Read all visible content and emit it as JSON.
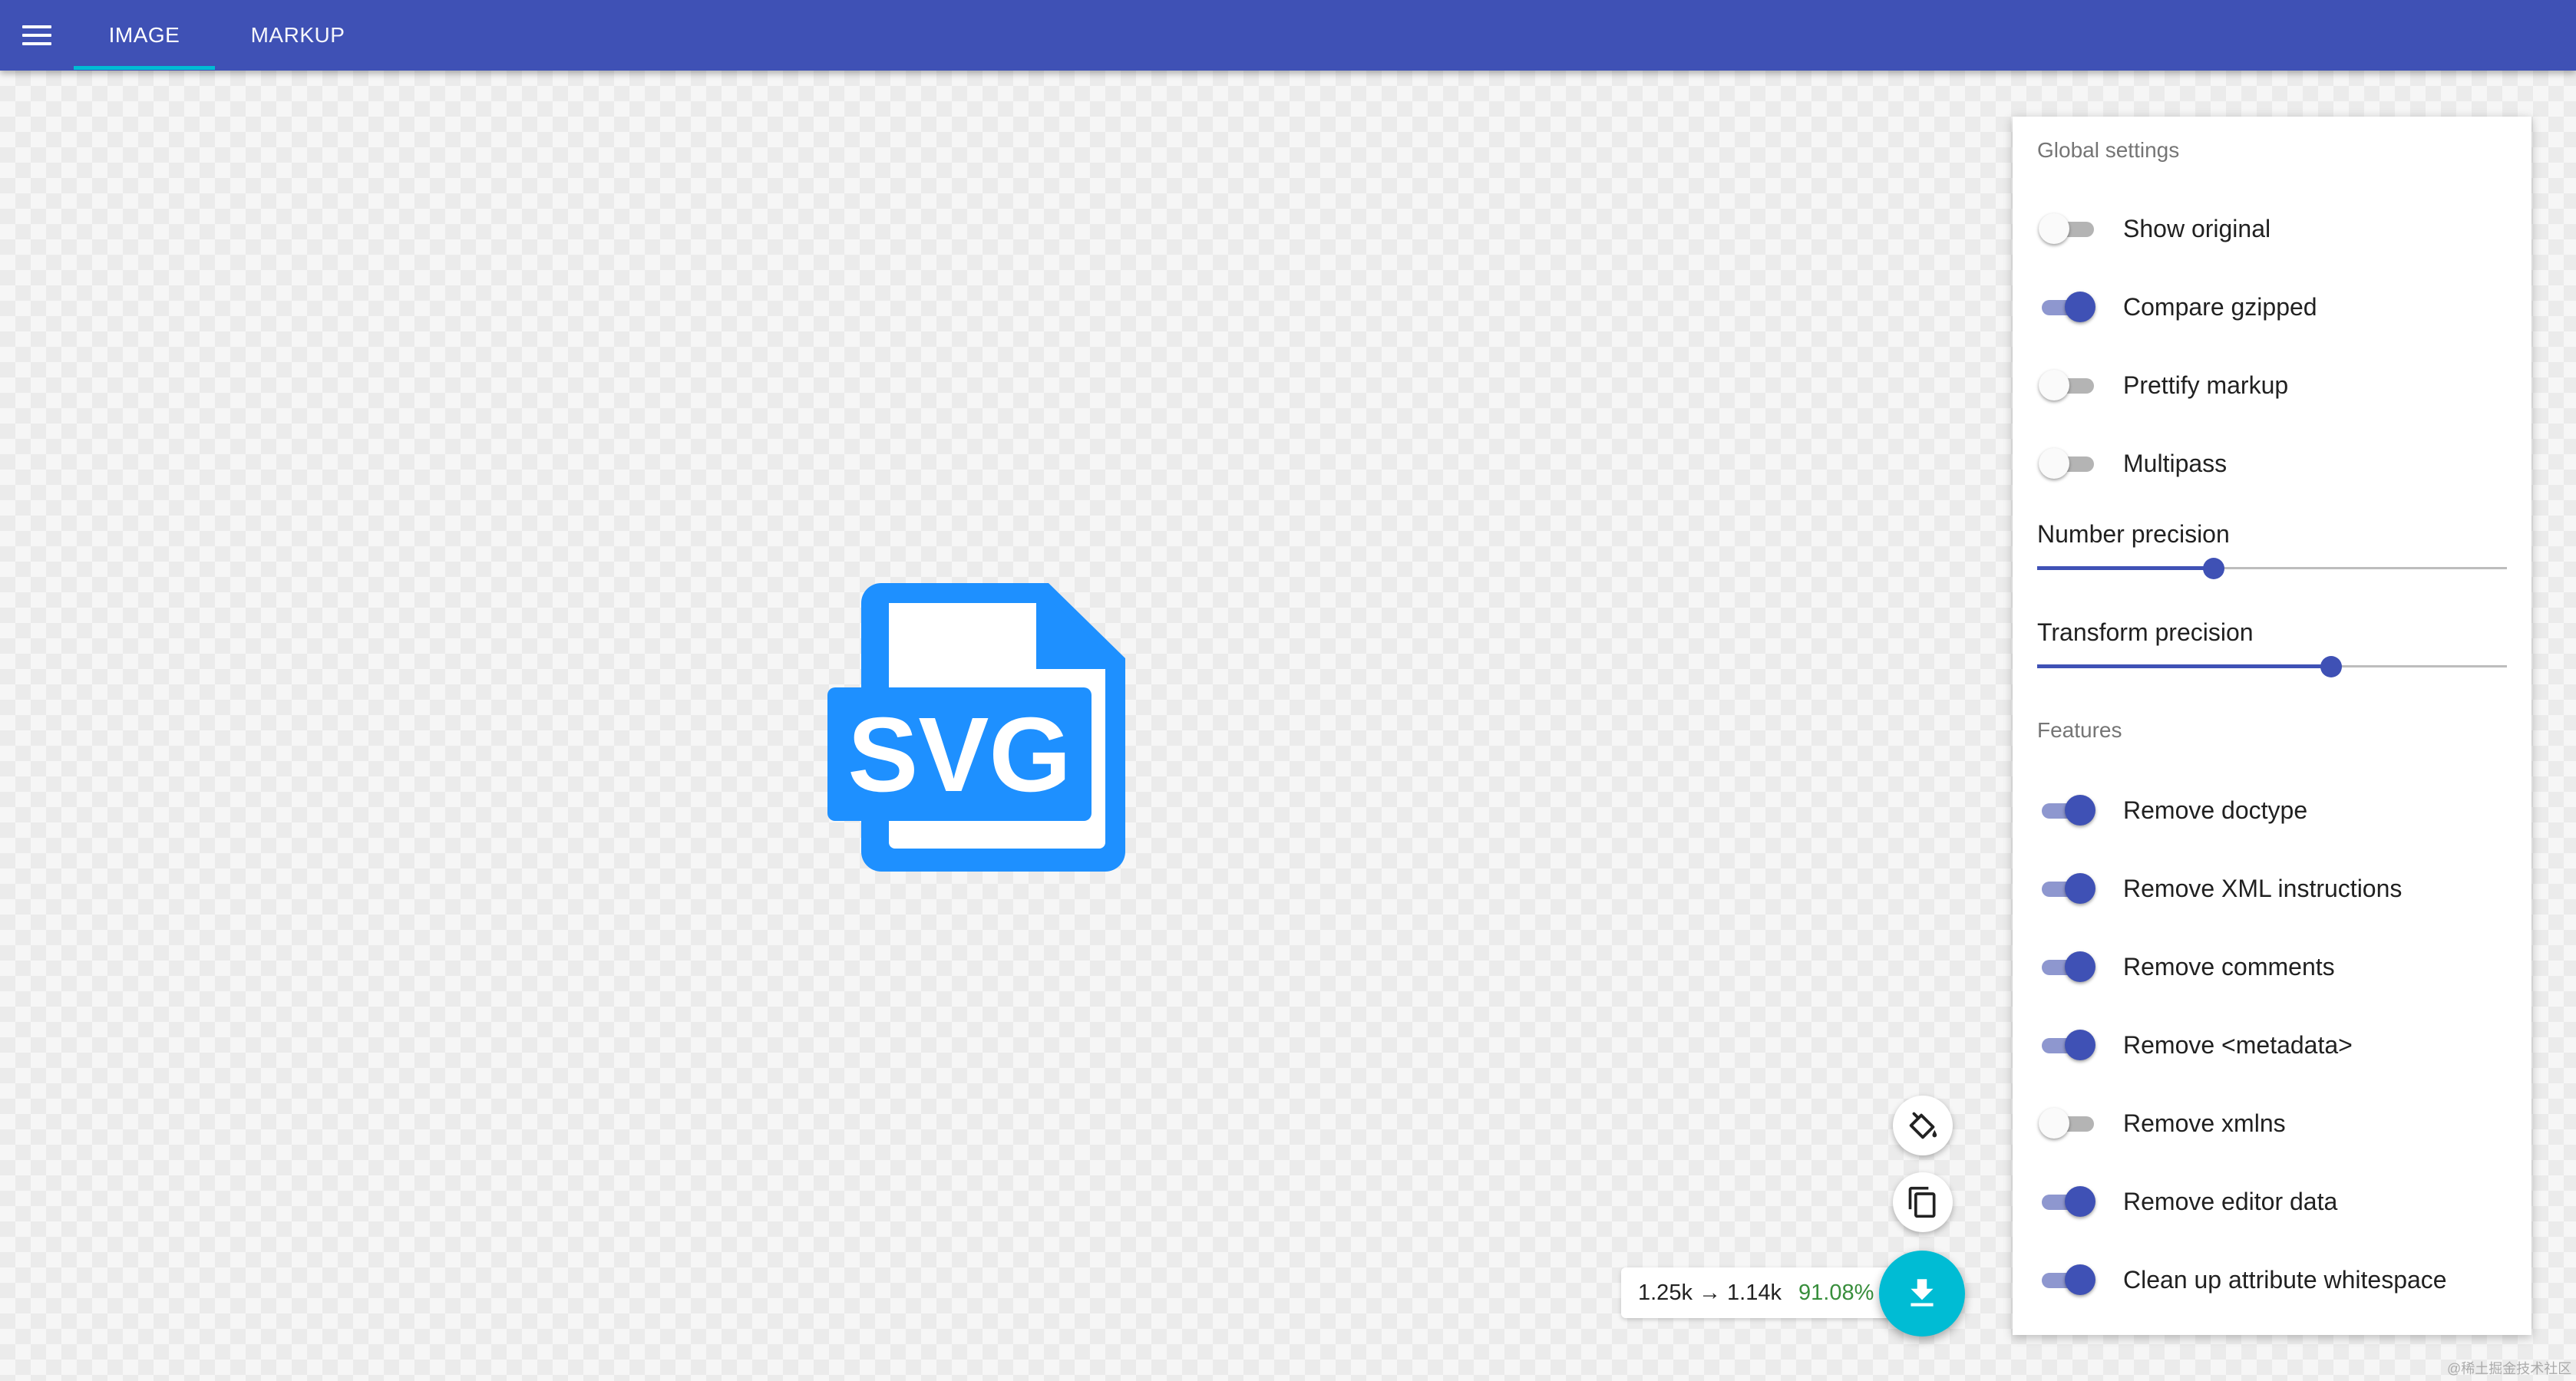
{
  "header": {
    "menu_icon": "menu-icon",
    "tabs": [
      {
        "label": "IMAGE",
        "active": true
      },
      {
        "label": "MARKUP",
        "active": false
      }
    ],
    "bar_color": "#3f51b5",
    "indicator_color": "#00bcd4"
  },
  "preview": {
    "icon": "svg-file-icon",
    "badge_text": "SVG",
    "color": "#1e90ff"
  },
  "actions": {
    "paint_icon": "paint-bucket-icon",
    "copy_icon": "copy-icon",
    "download_icon": "download-icon",
    "download_color": "#00bcd4"
  },
  "result": {
    "sizes": "1.25k → 1.14k",
    "percent": "91.08%"
  },
  "settings": {
    "global_title": "Global settings",
    "global": [
      {
        "label": "Show original",
        "on": false
      },
      {
        "label": "Compare gzipped",
        "on": true
      },
      {
        "label": "Prettify markup",
        "on": false
      },
      {
        "label": "Multipass",
        "on": false
      }
    ],
    "sliders": [
      {
        "label": "Number precision",
        "value_fraction": 0.375
      },
      {
        "label": "Transform precision",
        "value_fraction": 0.625
      }
    ],
    "features_title": "Features",
    "features": [
      {
        "label": "Remove doctype",
        "on": true
      },
      {
        "label": "Remove XML instructions",
        "on": true
      },
      {
        "label": "Remove comments",
        "on": true
      },
      {
        "label": "Remove <metadata>",
        "on": true
      },
      {
        "label": "Remove xmlns",
        "on": false
      },
      {
        "label": "Remove editor data",
        "on": true
      },
      {
        "label": "Clean up attribute whitespace",
        "on": true
      }
    ]
  },
  "watermark": "@稀土掘金技术社区"
}
